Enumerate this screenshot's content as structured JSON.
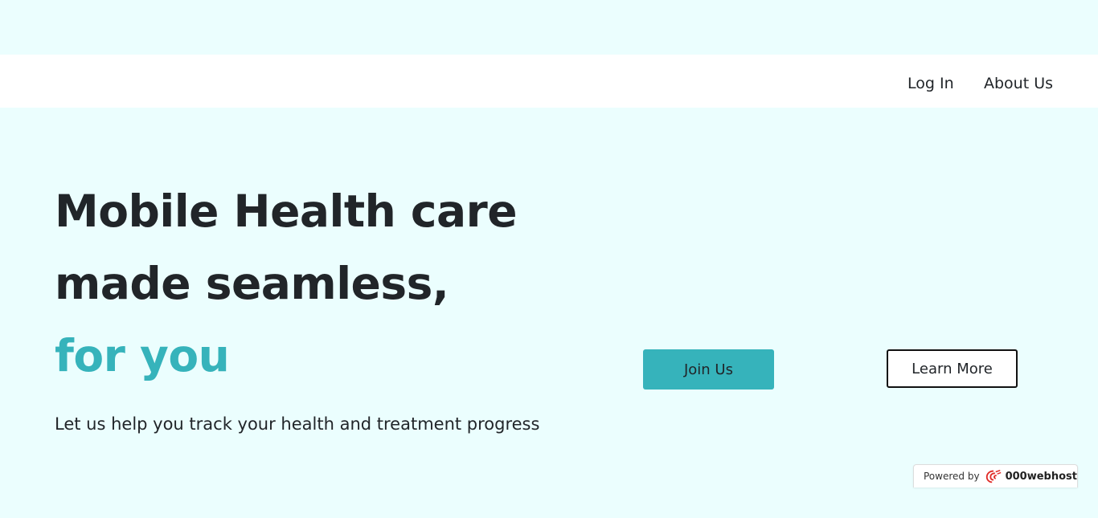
{
  "nav": {
    "login_label": "Log In",
    "about_label": "About Us"
  },
  "hero": {
    "line1": "Mobile Health care",
    "line2": "made seamless,",
    "line3": "for you",
    "subtitle": "Let us help you track your health and treatment progress",
    "accent_color": "#36b3bb"
  },
  "actions": {
    "join_label": "Join Us",
    "learn_label": "Learn More"
  },
  "footer_badge": {
    "powered_text": "Powered by",
    "brand": "000webhost",
    "logo_icon": "000webhost-logo-icon"
  },
  "colors": {
    "background": "#ebfefe",
    "navbar": "#ffffff",
    "text": "#212529"
  }
}
